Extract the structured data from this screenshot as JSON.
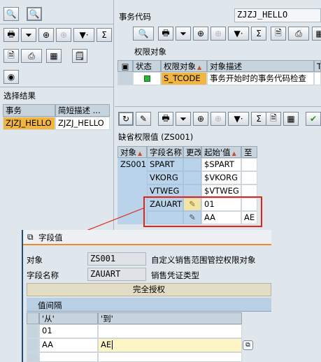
{
  "left": {
    "result_title": "选择结果",
    "col_tx": "事务",
    "col_desc": "简短描述 ...",
    "row_tx": "ZJZJ_HELLO",
    "row_desc": "ZJZJ_HELLO"
  },
  "right": {
    "tcode_label": "事务代码",
    "tcode_value": "ZJZJ_HELLO",
    "auth_obj_title": "权限对象",
    "grid1": {
      "col_status": "状态",
      "col_obj": "权限对象",
      "col_desc": "对象描述",
      "col_extra": "T",
      "row_obj": "S_TCODE",
      "row_desc": "事务开始时的事务代码检查"
    },
    "default_title": "缺省权限值 (ZS001)",
    "grid2": {
      "col_obj": "对象",
      "col_field": "字段名称",
      "col_change": "更改",
      "col_from": "起始'值",
      "col_to": "至",
      "obj": "ZS001",
      "rows": [
        {
          "field": "SPART",
          "from": "$SPART",
          "to": ""
        },
        {
          "field": "VKORG",
          "from": "$VKORG",
          "to": ""
        },
        {
          "field": "VTWEG",
          "from": "$VTWEG",
          "to": ""
        },
        {
          "field": "ZAUART",
          "from": "01",
          "to": ""
        },
        {
          "field": "",
          "from": "AA",
          "to": "AE"
        }
      ]
    }
  },
  "dialog": {
    "title": "字段值",
    "obj_label": "对象",
    "obj_value": "ZS001",
    "obj_desc": "自定义销售范围管控权限对象",
    "field_label": "字段名称",
    "field_value": "ZAUART",
    "field_desc": "销售凭证类型",
    "full_auth": "完全授权",
    "interval_title": "值间隔",
    "col_from": "'从'",
    "col_to": "'到'",
    "rows": [
      {
        "from": "01",
        "to": ""
      },
      {
        "from": "AA",
        "to": "AE"
      }
    ]
  },
  "colors": {
    "highlight_red": "#e0231b",
    "sap_blue": "#dce9f5",
    "orange": "#ee8a28"
  }
}
